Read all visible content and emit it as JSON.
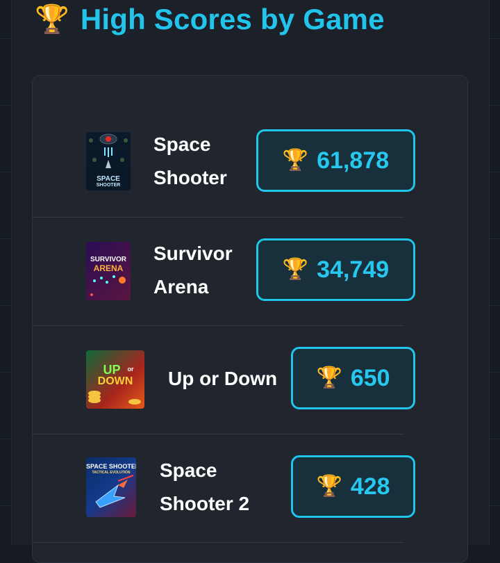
{
  "header": {
    "trophy_icon": "🏆",
    "title": "High Scores by Game"
  },
  "games": [
    {
      "name_line1": "Space",
      "name_line2": "Shooter",
      "score": "61,878",
      "thumb_text": [
        "SPACE",
        "SHOOTER"
      ],
      "icon": "trophy-icon"
    },
    {
      "name_line1": "Survivor",
      "name_line2": "Arena",
      "score": "34,749",
      "thumb_text": [
        "SURVIVOR",
        "ARENA"
      ],
      "icon": "trophy-icon"
    },
    {
      "name_line1": "Up or Down",
      "name_line2": "",
      "score": "650",
      "thumb_text": [
        "UP",
        "or",
        "DOWN"
      ],
      "icon": "trophy-icon"
    },
    {
      "name_line1": "Space",
      "name_line2": "Shooter 2",
      "score": "428",
      "thumb_text": [
        "SPACE SHOOTER",
        "TACTICAL EVOLUTION"
      ],
      "icon": "trophy-icon"
    }
  ],
  "colors": {
    "accent": "#22c4ec",
    "background": "#161b23",
    "card": "#20252e"
  }
}
